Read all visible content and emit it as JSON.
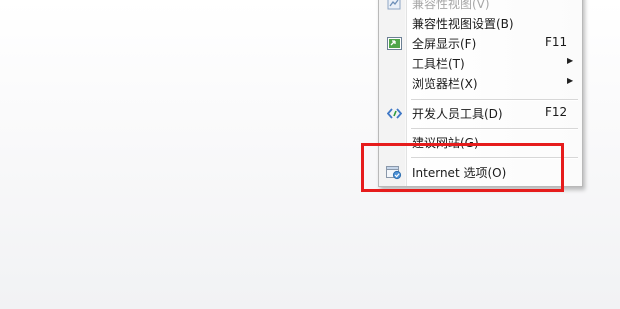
{
  "menu": {
    "items": [
      {
        "label": "兼容性视图(V)",
        "shortcut": "",
        "submenu": false,
        "icon": "compatibility-view-icon",
        "disabled": true
      },
      {
        "label": "兼容性视图设置(B)",
        "shortcut": "",
        "submenu": false,
        "icon": "",
        "disabled": false
      },
      {
        "label": "全屏显示(F)",
        "shortcut": "F11",
        "submenu": false,
        "icon": "fullscreen-icon",
        "disabled": false
      },
      {
        "label": "工具栏(T)",
        "shortcut": "",
        "submenu": true,
        "icon": "",
        "disabled": false
      },
      {
        "label": "浏览器栏(X)",
        "shortcut": "",
        "submenu": true,
        "icon": "",
        "disabled": false
      },
      {
        "label": "开发人员工具(D)",
        "shortcut": "F12",
        "submenu": false,
        "icon": "developer-tools-icon",
        "disabled": false
      },
      {
        "label": "建议网站(G)",
        "shortcut": "",
        "submenu": false,
        "icon": "",
        "disabled": false
      },
      {
        "label": "Internet 选项(O)",
        "shortcut": "",
        "submenu": false,
        "icon": "internet-options-icon",
        "disabled": false
      }
    ],
    "submenu_arrow": "▶"
  },
  "colors": {
    "highlight_box": "#e61c1c",
    "menu_border": "#b9b9b9",
    "disabled_text": "#a7a7a7"
  }
}
